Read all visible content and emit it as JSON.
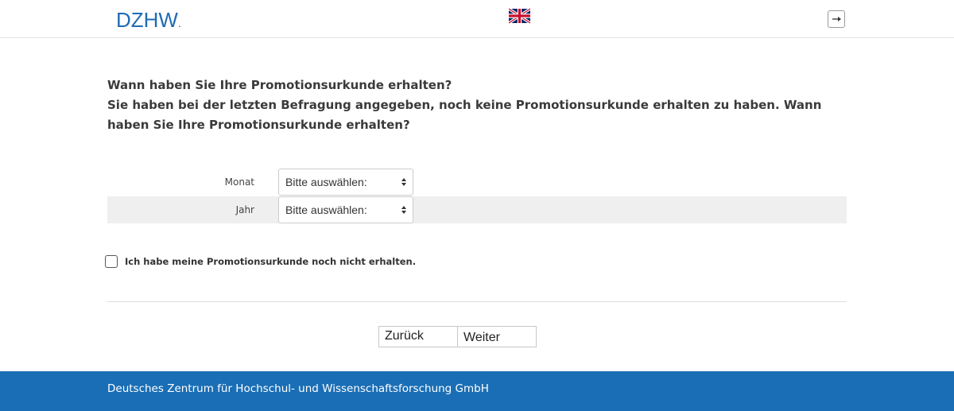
{
  "header": {
    "logo_text": "DZHW",
    "logo_dot": ".",
    "language_flag_icon": "uk-flag-icon",
    "logout_icon": "logout-icon"
  },
  "question": {
    "line1": "Wann haben Sie Ihre Promotionsurkunde erhalten?",
    "line2": "Sie haben bei der letzten Befragung angegeben, noch keine Promotionsurkunde erhalten zu haben. Wann haben Sie Ihre Promotionsurkunde erhalten?"
  },
  "fields": [
    {
      "label": "Monat",
      "value": "Bitte auswählen:"
    },
    {
      "label": "Jahr",
      "value": "Bitte auswählen:"
    }
  ],
  "checkbox": {
    "label": "Ich habe meine Promotionsurkunde noch nicht erhalten.",
    "checked": false
  },
  "navigation": {
    "back_label": "Zurück",
    "next_label": "Weiter"
  },
  "footer": {
    "text": "Deutsches Zentrum für Hochschul- und Wissenschaftsforschung GmbH"
  },
  "colors": {
    "brand_blue": "#1f6cb4",
    "footer_blue": "#1a6eb5"
  }
}
